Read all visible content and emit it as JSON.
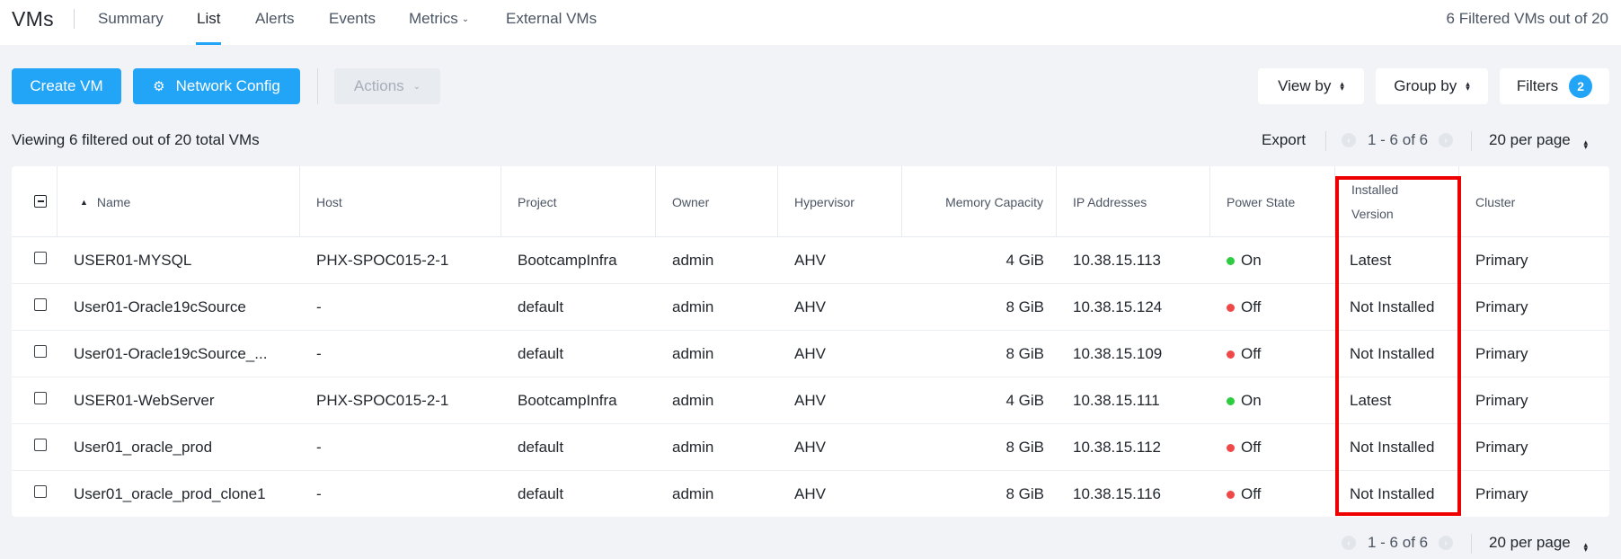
{
  "app": {
    "title": "VMs"
  },
  "tabs": [
    {
      "label": "Summary"
    },
    {
      "label": "List"
    },
    {
      "label": "Alerts"
    },
    {
      "label": "Events"
    },
    {
      "label": "Metrics"
    },
    {
      "label": "External VMs"
    }
  ],
  "vm_count": "6 Filtered VMs out of 20",
  "toolbar": {
    "create_vm": "Create VM",
    "network_config": "Network Config",
    "actions": "Actions",
    "view_by": "View by",
    "group_by": "Group by",
    "filters": "Filters",
    "filters_count": "2"
  },
  "viewing_text": "Viewing 6 filtered out of 20 total VMs",
  "export_label": "Export",
  "pagination": {
    "range": "1 - 6 of 6",
    "per_page": "20 per page"
  },
  "table": {
    "headers": {
      "name": "Name",
      "host": "Host",
      "project": "Project",
      "owner": "Owner",
      "hypervisor": "Hypervisor",
      "memory": "Memory Capacity",
      "ip": "IP Addresses",
      "power": "Power State",
      "installed_line1": "Installed",
      "installed_line2": "Version",
      "cluster": "Cluster"
    },
    "rows": [
      {
        "name": "USER01-MYSQL",
        "host": "PHX-SPOC015-2-1",
        "project": "BootcampInfra",
        "owner": "admin",
        "hypervisor": "AHV",
        "memory": "4 GiB",
        "ip": "10.38.15.113",
        "power": "On",
        "installed": "Latest",
        "cluster": "Primary"
      },
      {
        "name": "User01-Oracle19cSource",
        "host": "-",
        "project": "default",
        "owner": "admin",
        "hypervisor": "AHV",
        "memory": "8 GiB",
        "ip": "10.38.15.124",
        "power": "Off",
        "installed": "Not Installed",
        "cluster": "Primary"
      },
      {
        "name": "User01-Oracle19cSource_...",
        "host": "-",
        "project": "default",
        "owner": "admin",
        "hypervisor": "AHV",
        "memory": "8 GiB",
        "ip": "10.38.15.109",
        "power": "Off",
        "installed": "Not Installed",
        "cluster": "Primary"
      },
      {
        "name": "USER01-WebServer",
        "host": "PHX-SPOC015-2-1",
        "project": "BootcampInfra",
        "owner": "admin",
        "hypervisor": "AHV",
        "memory": "4 GiB",
        "ip": "10.38.15.111",
        "power": "On",
        "installed": "Latest",
        "cluster": "Primary"
      },
      {
        "name": "User01_oracle_prod",
        "host": "-",
        "project": "default",
        "owner": "admin",
        "hypervisor": "AHV",
        "memory": "8 GiB",
        "ip": "10.38.15.112",
        "power": "Off",
        "installed": "Not Installed",
        "cluster": "Primary"
      },
      {
        "name": "User01_oracle_prod_clone1",
        "host": "-",
        "project": "default",
        "owner": "admin",
        "hypervisor": "AHV",
        "memory": "8 GiB",
        "ip": "10.38.15.116",
        "power": "Off",
        "installed": "Not Installed",
        "cluster": "Primary"
      }
    ]
  },
  "colors": {
    "accent": "#22a5f7",
    "power_on": "#2ecc40",
    "power_off": "#f04848",
    "highlight": "#ee0000"
  }
}
